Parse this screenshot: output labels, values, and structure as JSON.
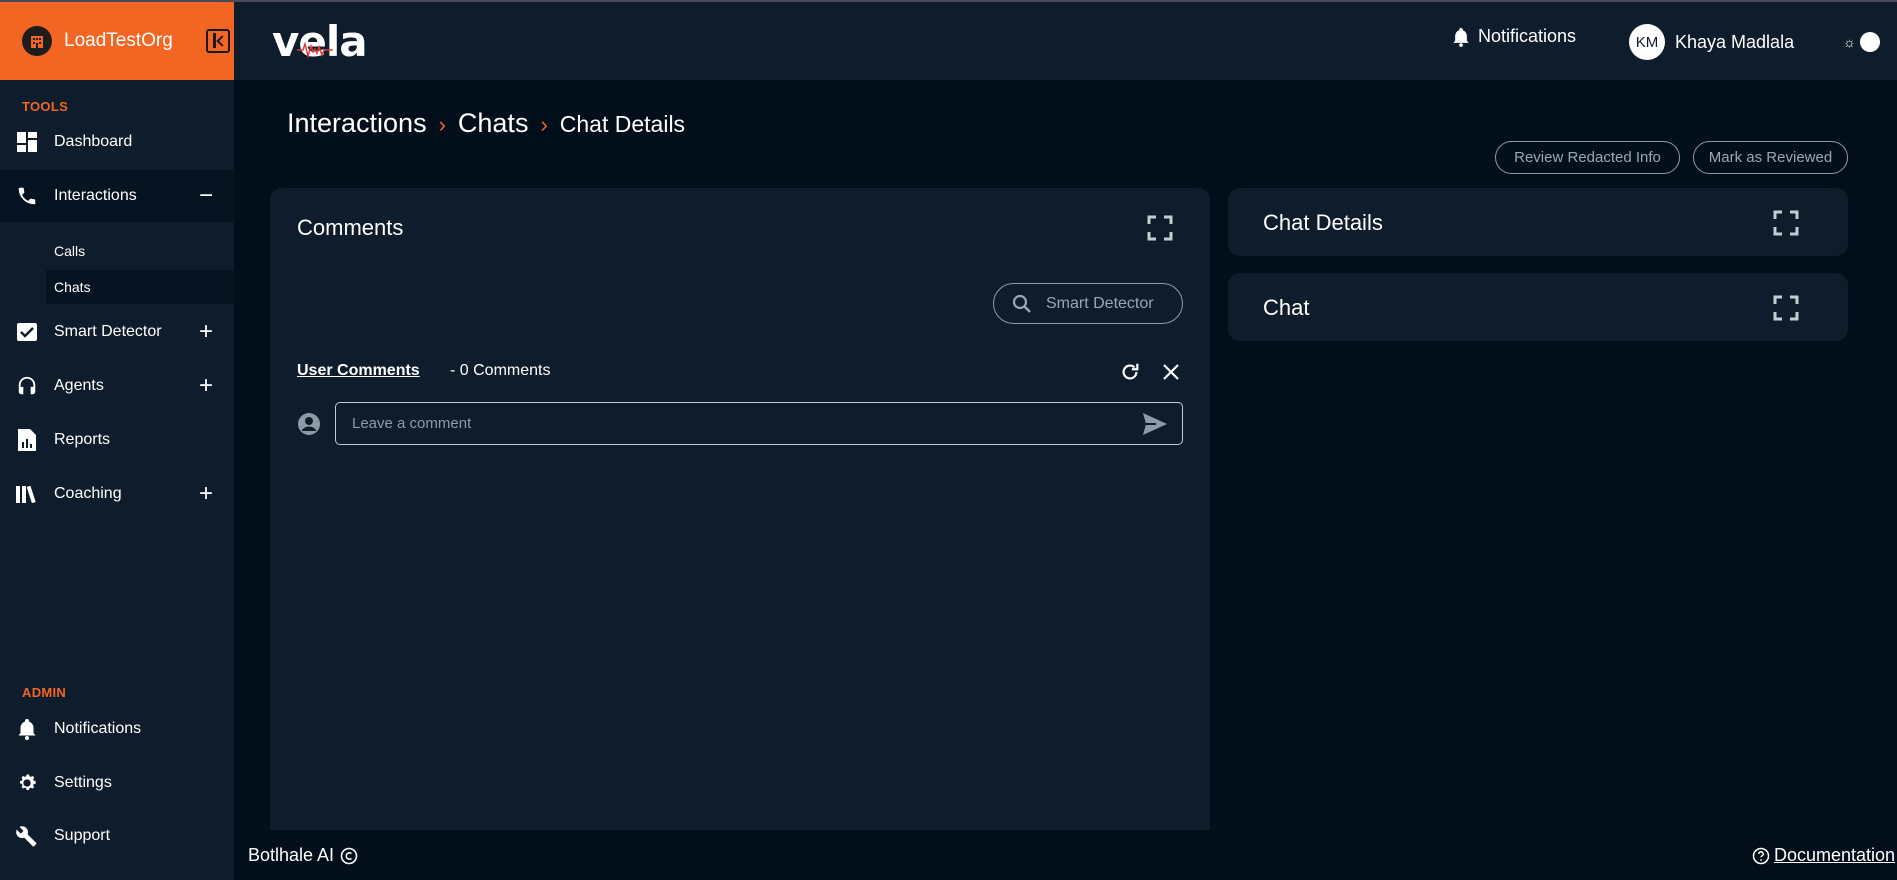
{
  "org": {
    "name": "LoadTestOrg"
  },
  "header": {
    "logo_text": "vela",
    "notifications_label": "Notifications",
    "user_initials": "KM",
    "user_name": "Khaya Madlala"
  },
  "sidebar": {
    "tools_label": "TOOLS",
    "admin_label": "ADMIN",
    "items": {
      "dashboard": "Dashboard",
      "interactions": "Interactions",
      "calls": "Calls",
      "chats": "Chats",
      "smart_detector": "Smart Detector",
      "agents": "Agents",
      "reports": "Reports",
      "coaching": "Coaching",
      "notifications": "Notifications",
      "settings": "Settings",
      "support": "Support"
    },
    "toggles": {
      "minus": "−",
      "plus": "+"
    }
  },
  "breadcrumb": {
    "level1": "Interactions",
    "level2": "Chats",
    "level3": "Chat Details",
    "separator": "›"
  },
  "actions": {
    "review_redacted": "Review Redacted Info",
    "mark_reviewed": "Mark as Reviewed"
  },
  "comments_panel": {
    "title": "Comments",
    "search_placeholder": "Smart Detector",
    "user_comments_label": "User Comments",
    "comment_count": "- 0 Comments",
    "comment_placeholder": "Leave a comment"
  },
  "chat_details_panel": {
    "title": "Chat Details"
  },
  "chat_panel": {
    "title": "Chat"
  },
  "footer": {
    "brand": "Botlhale AI",
    "documentation": "Documentation"
  },
  "colors": {
    "accent": "#f26522",
    "panel": "#0f1c2b",
    "background": "#020f1a"
  }
}
